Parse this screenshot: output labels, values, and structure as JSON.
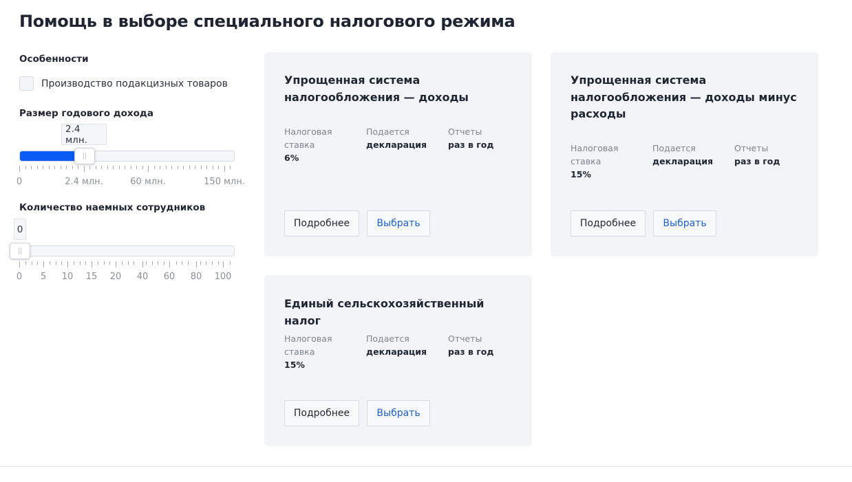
{
  "page": {
    "title": "Помощь в выборе специального налогового режима"
  },
  "filters": {
    "features": {
      "heading": "Особенности",
      "checkbox_label": "Производство подакцизных товаров",
      "checked": false
    },
    "income": {
      "heading": "Размер годового дохода",
      "value_label": "2.4 млн.",
      "fill_fraction": 0.3,
      "tick_labels": [
        "0",
        "2.4 млн.",
        "60 млн.",
        "150 млн."
      ]
    },
    "employees": {
      "heading": "Количество наемных сотрудников",
      "value_label": "0",
      "fill_fraction": 0,
      "tick_labels": [
        "0",
        "5",
        "10",
        "15",
        "20",
        "40",
        "60",
        "80",
        "100"
      ]
    },
    "accent_color": "#0a5cf5"
  },
  "cards": [
    {
      "title": "Упрощенная система налогообложения — доходы",
      "props": [
        {
          "label": "Налоговая ставка",
          "value": "6%"
        },
        {
          "label": "Подается",
          "value": "декларация"
        },
        {
          "label": "Отчеты",
          "value": "раз в год"
        }
      ],
      "details_label": "Подробнее",
      "select_label": "Выбрать"
    },
    {
      "title": "Упрощенная система налогообложения — доходы минус расходы",
      "props": [
        {
          "label": "Налоговая ставка",
          "value": "15%"
        },
        {
          "label": "Подается",
          "value": "декларация"
        },
        {
          "label": "Отчеты",
          "value": "раз в год"
        }
      ],
      "details_label": "Подробнее",
      "select_label": "Выбрать"
    },
    {
      "title": "Единый сельскохозяйственный налог",
      "props": [
        {
          "label": "Налоговая ставка",
          "value": "15%"
        },
        {
          "label": "Подается",
          "value": "декларация"
        },
        {
          "label": "Отчеты",
          "value": "раз в год"
        }
      ],
      "details_label": "Подробнее",
      "select_label": "Выбрать"
    }
  ]
}
